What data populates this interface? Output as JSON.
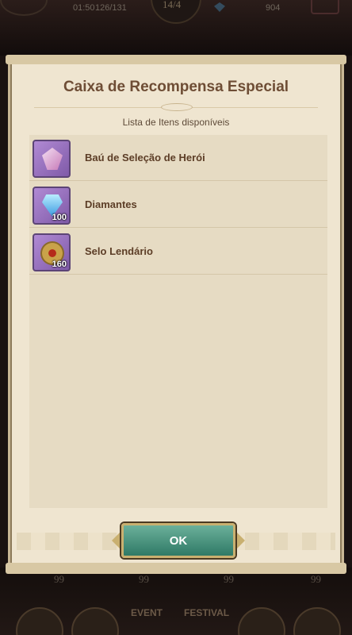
{
  "hud": {
    "time": "01:50",
    "stamina": "126/131",
    "stage": "14/4",
    "gems": "904"
  },
  "dialog": {
    "title": "Caixa de Recompensa Especial",
    "subtitle": "Lista de Itens disponíveis",
    "items": [
      {
        "label": "Baú de Seleção de Herói",
        "icon": "hero-chest-icon",
        "quantity": ""
      },
      {
        "label": "Diamantes",
        "icon": "diamond-icon",
        "quantity": "100"
      },
      {
        "label": "Selo Lendário",
        "icon": "legendary-seal-icon",
        "quantity": "160"
      }
    ],
    "ok_label": "OK"
  },
  "bottom": {
    "counts": [
      "99",
      "99",
      "99",
      "99"
    ],
    "badges": [
      "EVENT",
      "FESTIVAL"
    ]
  },
  "colors": {
    "parchment": "#efe5d0",
    "title_brown": "#6e4d35",
    "ok_green": "#2f7a66",
    "gold_border": "#c9b070"
  }
}
